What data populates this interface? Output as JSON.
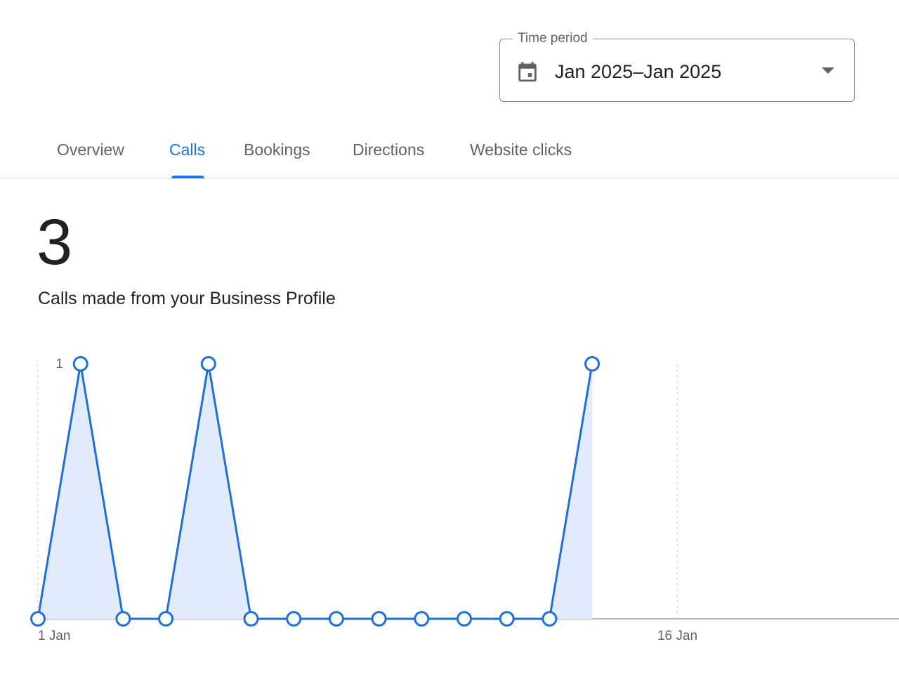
{
  "time_period": {
    "label": "Time period",
    "value": "Jan 2025–Jan 2025",
    "icon": "calendar-icon"
  },
  "tabs": [
    {
      "label": "Overview",
      "active": false
    },
    {
      "label": "Calls",
      "active": true
    },
    {
      "label": "Bookings",
      "active": false
    },
    {
      "label": "Directions",
      "active": false
    },
    {
      "label": "Website clicks",
      "active": false
    }
  ],
  "stat": {
    "value": "3",
    "description": "Calls made from your Business Profile"
  },
  "colors": {
    "accent": "#1a73e8",
    "line": "#1f6fd9",
    "fill": "#e2ebfb",
    "text_secondary": "#5f6368"
  },
  "chart_data": {
    "type": "area",
    "x_days": [
      1,
      2,
      3,
      4,
      5,
      6,
      7,
      8,
      9,
      10,
      11,
      12,
      13,
      14
    ],
    "values": [
      0,
      1,
      0,
      0,
      1,
      0,
      0,
      0,
      0,
      0,
      0,
      0,
      0,
      1
    ],
    "x_range": [
      1,
      21
    ],
    "y_range": [
      0,
      1
    ],
    "y_tick_labels": [
      "1"
    ],
    "x_tick_labels": [
      {
        "day": 1,
        "label": "1 Jan"
      },
      {
        "day": 16,
        "label": "16 Jan"
      }
    ],
    "grid": "vertical dashed at x ticks",
    "markers": "hollow circles"
  }
}
